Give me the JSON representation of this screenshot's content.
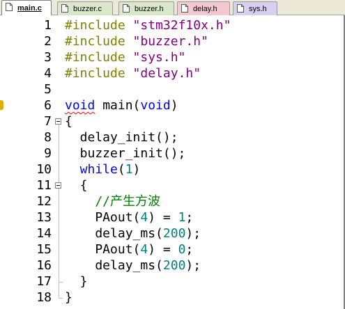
{
  "tabs": [
    {
      "label": "main.c",
      "active": true,
      "color": "#ffffff"
    },
    {
      "label": "buzzer.c",
      "active": false,
      "color": "#d8e8c8"
    },
    {
      "label": "buzzer.h",
      "active": false,
      "color": "#d8e8c8"
    },
    {
      "label": "delay.h",
      "active": false,
      "color": "#f4c8d0"
    },
    {
      "label": "sys.h",
      "active": false,
      "color": "#d8d0f0"
    }
  ],
  "editor": {
    "lines": [
      {
        "n": "1",
        "tokens": [
          [
            "pp",
            "#include "
          ],
          [
            "str",
            "\"stm32f10x.h\""
          ]
        ]
      },
      {
        "n": "2",
        "tokens": [
          [
            "pp",
            "#include "
          ],
          [
            "str",
            "\"buzzer.h\""
          ]
        ]
      },
      {
        "n": "3",
        "tokens": [
          [
            "pp",
            "#include "
          ],
          [
            "str",
            "\"sys.h\""
          ]
        ]
      },
      {
        "n": "4",
        "tokens": [
          [
            "pp",
            "#include "
          ],
          [
            "str",
            "\"delay.h\""
          ]
        ]
      },
      {
        "n": "5",
        "tokens": []
      },
      {
        "n": "6",
        "tokens": [
          [
            "kw squig",
            "void"
          ],
          [
            "",
            " main("
          ],
          [
            "kw",
            "void"
          ],
          [
            "",
            ")"
          ]
        ]
      },
      {
        "n": "7",
        "tokens": [
          [
            "",
            "{"
          ]
        ]
      },
      {
        "n": "8",
        "tokens": [
          [
            "",
            "  delay_init();"
          ]
        ]
      },
      {
        "n": "9",
        "tokens": [
          [
            "",
            "  buzzer_init();"
          ]
        ]
      },
      {
        "n": "10",
        "tokens": [
          [
            "kw",
            "  while"
          ],
          [
            "",
            "("
          ],
          [
            "num",
            "1"
          ],
          [
            "",
            ")"
          ]
        ]
      },
      {
        "n": "11",
        "tokens": [
          [
            "",
            "  {"
          ]
        ]
      },
      {
        "n": "12",
        "tokens": [
          [
            "cmt",
            "    //产生方波"
          ]
        ]
      },
      {
        "n": "13",
        "tokens": [
          [
            "",
            "    PAout("
          ],
          [
            "num",
            "4"
          ],
          [
            "",
            ") = "
          ],
          [
            "num",
            "1"
          ],
          [
            "",
            ";"
          ]
        ]
      },
      {
        "n": "14",
        "tokens": [
          [
            "",
            "    delay_ms("
          ],
          [
            "num",
            "200"
          ],
          [
            "",
            ");"
          ]
        ]
      },
      {
        "n": "15",
        "tokens": [
          [
            "",
            "    PAout("
          ],
          [
            "num",
            "4"
          ],
          [
            "",
            ") = "
          ],
          [
            "num",
            "0"
          ],
          [
            "",
            ";"
          ]
        ]
      },
      {
        "n": "16",
        "tokens": [
          [
            "",
            "    delay_ms("
          ],
          [
            "num",
            "200"
          ],
          [
            "",
            ");"
          ]
        ]
      },
      {
        "n": "17",
        "tokens": [
          [
            "",
            "  }"
          ]
        ]
      },
      {
        "n": "18",
        "tokens": [
          [
            "",
            "}"
          ]
        ]
      }
    ],
    "fold_lines": [
      "7",
      "11"
    ]
  }
}
